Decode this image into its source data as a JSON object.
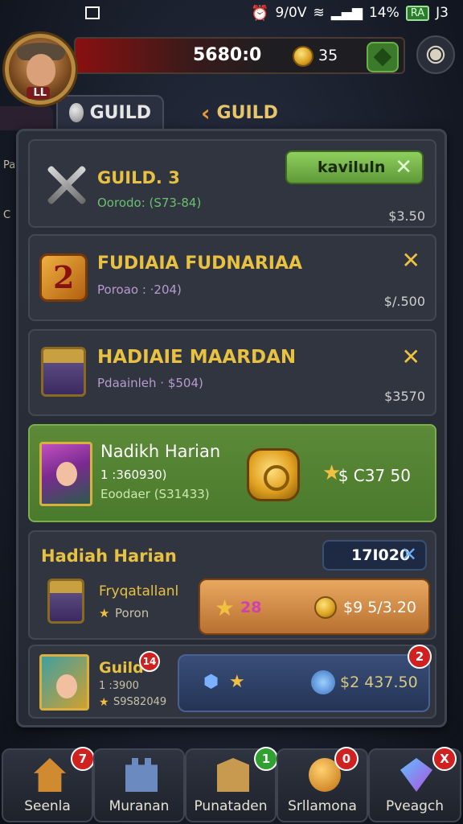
{
  "status": {
    "time": " ",
    "net": "9/0V",
    "battery_pct": "14%",
    "battery": "RA",
    "end": "J3"
  },
  "top": {
    "level": " LL",
    "gold": "5680:0",
    "coins": "35"
  },
  "tabs": [
    {
      "label": "GUILD"
    },
    {
      "label": "GUILD"
    }
  ],
  "side": {
    "a": "Pa",
    "b": "C"
  },
  "cards": [
    {
      "title": "GUILD. 3",
      "sub": "Oorodo: (S73-84)",
      "button": "kaviluln",
      "price": "$3.50"
    },
    {
      "title": "FUDIAIA FUDNARIAA",
      "sub": "Poroao : ·204)",
      "price": "$/.500"
    },
    {
      "title": "HADIAIE MAARDAN",
      "sub": "Pdaainleh · $504)",
      "price": "$3570"
    },
    {
      "title": "Nadikh Harian",
      "line1": "1 :360930)",
      "sub": "Eoodaer (S31433)",
      "price": "$ C37 50"
    },
    {
      "title": "Hadiah Harian",
      "pill": "17I020",
      "name": "Fryqatallanl",
      "sub": "Poron",
      "btn_left": "28",
      "btn_right": "$9 5/3.20"
    },
    {
      "title": "Guild",
      "badge": "14",
      "line1": "1 :3900",
      "sub": "S9S82049",
      "btn_right": "$2 437.50",
      "btn_badge": "2"
    }
  ],
  "nav": [
    {
      "label": "Seenla",
      "badge": "7"
    },
    {
      "label": "Muranan",
      "badge": ""
    },
    {
      "label": "Punataden",
      "badge": "1"
    },
    {
      "label": "Srllamona",
      "badge": "0"
    },
    {
      "label": "Pveagch",
      "badge": "X"
    }
  ],
  "colors": {
    "accent_gold": "#e8c042",
    "green": "#5c8a38",
    "red_badge": "#d02020"
  }
}
